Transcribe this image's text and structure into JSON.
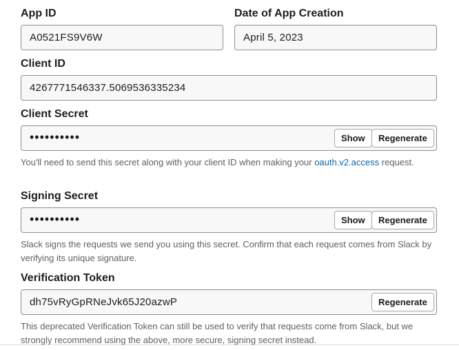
{
  "app_id": {
    "label": "App ID",
    "value": "A0521FS9V6W"
  },
  "creation_date": {
    "label": "Date of App Creation",
    "value": "April 5, 2023"
  },
  "client_id": {
    "label": "Client ID",
    "value": "4267771546337.5069536335234"
  },
  "client_secret": {
    "label": "Client Secret",
    "masked_value": "••••••••••",
    "show_label": "Show",
    "regenerate_label": "Regenerate",
    "help_before": "You'll need to send this secret along with your client ID when making your ",
    "help_link": "oauth.v2.access",
    "help_after": " request."
  },
  "signing_secret": {
    "label": "Signing Secret",
    "masked_value": "••••••••••",
    "show_label": "Show",
    "regenerate_label": "Regenerate",
    "help": "Slack signs the requests we send you using this secret. Confirm that each request comes from Slack by verifying its unique signature."
  },
  "verification_token": {
    "label": "Verification Token",
    "value": "dh75vRyGpRNeJvk65J20azwP",
    "regenerate_label": "Regenerate",
    "help": "This deprecated Verification Token can still be used to verify that requests come from Slack, but we strongly recommend using the above, more secure, signing secret instead."
  }
}
